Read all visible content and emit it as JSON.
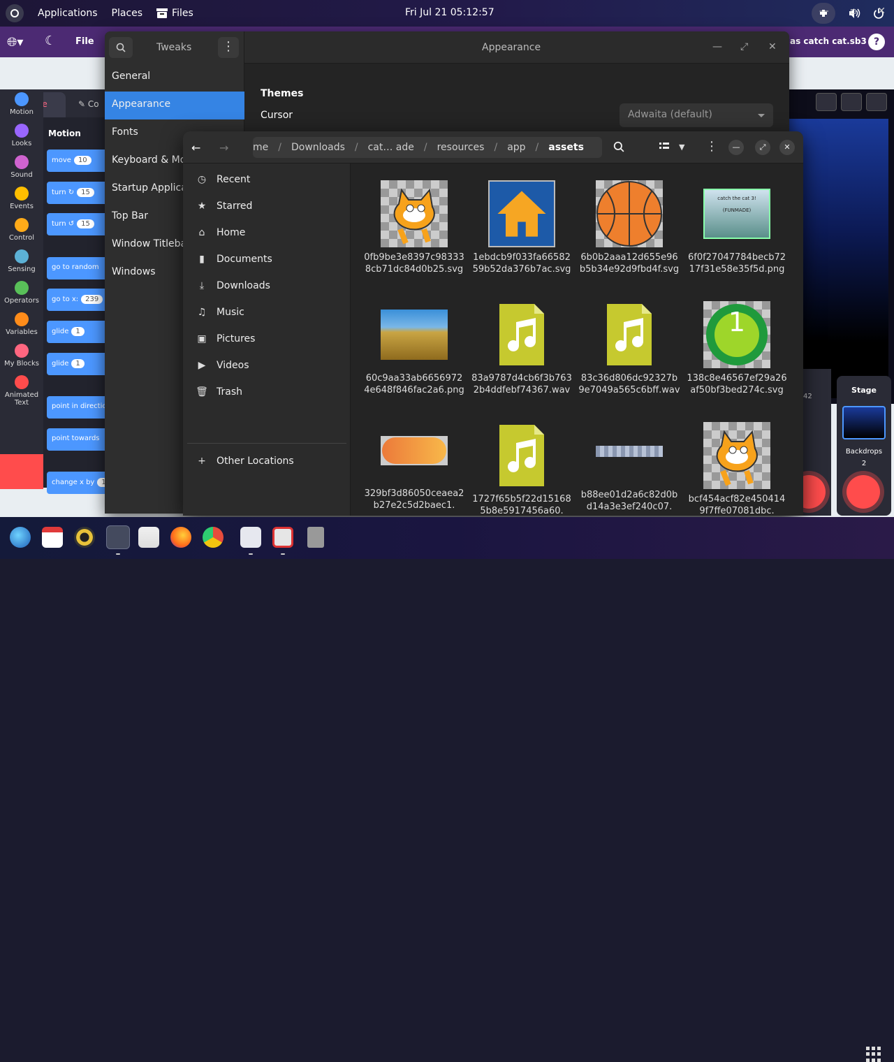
{
  "topbar": {
    "applications": "Applications",
    "places": "Places",
    "files": "Files",
    "clock": "Fri Jul 21  05:12:57"
  },
  "scratch": {
    "file_menu": "File",
    "title": "as catch cat.sb3",
    "help": "?",
    "code_tab": "Code",
    "costumes_tab": "Co",
    "palette_title": "Motion",
    "categories": [
      {
        "label": "Motion",
        "color": "#4c97ff"
      },
      {
        "label": "Looks",
        "color": "#9966ff"
      },
      {
        "label": "Sound",
        "color": "#cf63cf"
      },
      {
        "label": "Events",
        "color": "#ffbf00"
      },
      {
        "label": "Control",
        "color": "#ffab19"
      },
      {
        "label": "Sensing",
        "color": "#5cb1d6"
      },
      {
        "label": "Operators",
        "color": "#59c059"
      },
      {
        "label": "Variables",
        "color": "#ff8c1a"
      },
      {
        "label": "My Blocks",
        "color": "#ff6680"
      },
      {
        "label": "Animated Text",
        "color": "#ff4c4c"
      }
    ],
    "blocks": [
      {
        "text": "move",
        "num": "10"
      },
      {
        "text": "turn ↻",
        "num": "15"
      },
      {
        "text": "turn ↺",
        "num": "15"
      },
      {
        "text": "go to  random",
        "num": ""
      },
      {
        "text": "go to x:",
        "num": "239"
      },
      {
        "text": "glide",
        "num": "1"
      },
      {
        "text": "glide",
        "num": "1"
      },
      {
        "text": "point in direction",
        "num": ""
      },
      {
        "text": "point towards",
        "num": ""
      },
      {
        "text": "change x by",
        "num": "1"
      }
    ],
    "stage_label": "Stage",
    "backdrops_label": "Backdrops",
    "backdrops_count": "2",
    "sprite_value": "42"
  },
  "tweaks": {
    "title": "Tweaks",
    "header_title": "Appearance",
    "nav": [
      "General",
      "Appearance",
      "Fonts",
      "Keyboard & Mouse",
      "Startup Applications",
      "Top Bar",
      "Window Titlebars",
      "Windows"
    ],
    "selected_nav": "Appearance",
    "themes_heading": "Themes",
    "cursor_label": "Cursor",
    "cursor_value": "Adwaita (default)"
  },
  "files": {
    "breadcrumbs": [
      "me",
      "Downloads",
      "cat… ade",
      "resources",
      "app",
      "assets"
    ],
    "sidebar": [
      {
        "label": "Recent",
        "icon": "clock-icon"
      },
      {
        "label": "Starred",
        "icon": "star-icon"
      },
      {
        "label": "Home",
        "icon": "home-icon"
      },
      {
        "label": "Documents",
        "icon": "document-icon"
      },
      {
        "label": "Downloads",
        "icon": "download-icon"
      },
      {
        "label": "Music",
        "icon": "music-icon"
      },
      {
        "label": "Pictures",
        "icon": "pictures-icon"
      },
      {
        "label": "Videos",
        "icon": "video-icon"
      },
      {
        "label": "Trash",
        "icon": "trash-icon"
      }
    ],
    "other_locations": "Other Locations",
    "items": [
      {
        "name": "0fb9be3e8397c983338cb71dc84d0b25.svg",
        "thumb": "cat"
      },
      {
        "name": "1ebdcb9f033fa6658259b52da376b7ac.svg",
        "thumb": "house"
      },
      {
        "name": "6b0b2aaa12d655e96b5b34e92d9fbd4f.svg",
        "thumb": "ball"
      },
      {
        "name": "6f0f27047784becb7217f31e58e35f5d.png",
        "thumb": "poster"
      },
      {
        "name": "60c9aa33ab66569724e648f846fac2a6.png",
        "thumb": "field"
      },
      {
        "name": "83a9787d4cb6f3b7632b4ddfebf74367.wav",
        "thumb": "audio"
      },
      {
        "name": "83c36d806dc92327b9e7049a565c6bff.wav",
        "thumb": "audio"
      },
      {
        "name": "138c8e46567ef29a26af50bf3bed274c.svg",
        "thumb": "green-one"
      },
      {
        "name": "329bf3d86050ceaea2b27e2c5d2baec1.",
        "thumb": "pill"
      },
      {
        "name": "1727f65b5f22d151685b8e5917456a60.",
        "thumb": "audio"
      },
      {
        "name": "b88ee01d2a6c82d0bd14a3e3ef240c07.",
        "thumb": "strip"
      },
      {
        "name": "bcf454acf82e4504149f7ffe07081dbc.",
        "thumb": "cat"
      }
    ],
    "green_number": "1",
    "poster_text": "catch the cat 3! (FUNMADE)"
  }
}
